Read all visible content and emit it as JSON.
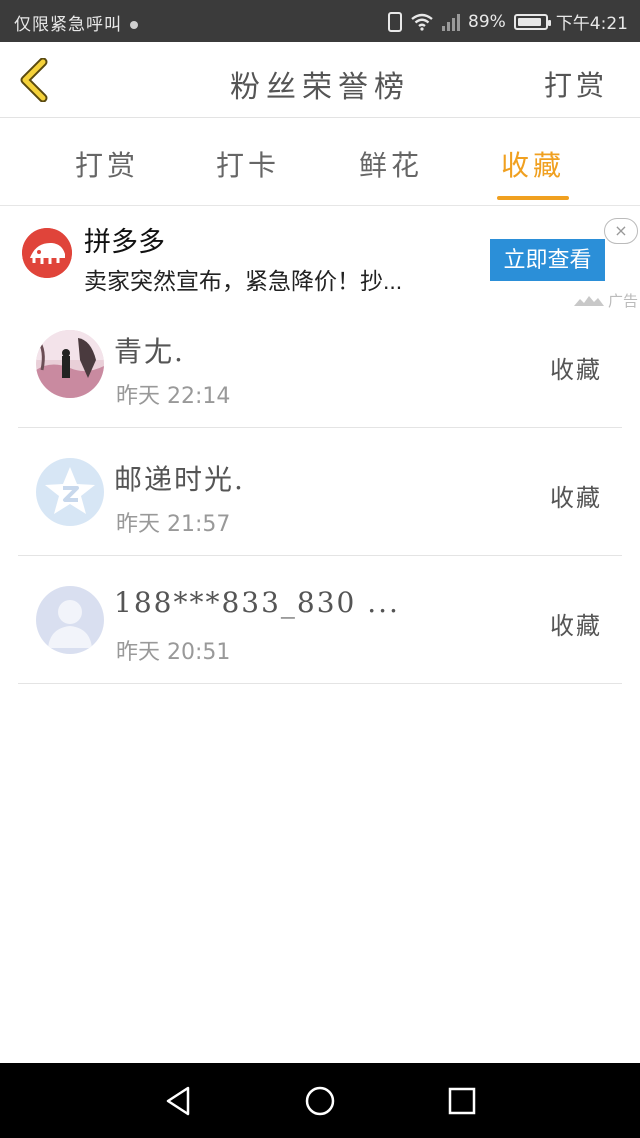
{
  "status_bar": {
    "carrier_text": "仅限紧急呼叫",
    "battery_level": "89%",
    "battery_fraction": 0.89,
    "clock": "下午4:21"
  },
  "header": {
    "title": "粉丝荣誉榜",
    "right_action": "打赏"
  },
  "tabs": [
    {
      "label": "打赏",
      "active": false
    },
    {
      "label": "打卡",
      "active": false
    },
    {
      "label": "鲜花",
      "active": false
    },
    {
      "label": "收藏",
      "active": true
    }
  ],
  "ad": {
    "title": "拼多多",
    "description": "卖家突然宣布，紧急降价！抄...",
    "button": "立即查看",
    "close": "×",
    "tag": "广告"
  },
  "list": [
    {
      "name": "青尢.",
      "time": "昨天 22:14",
      "action": "收藏"
    },
    {
      "name": "邮递时光.",
      "time": "昨天 21:57",
      "action": "收藏"
    },
    {
      "name": "188***833_830 ...",
      "time": "昨天 20:51",
      "action": "收藏"
    }
  ],
  "colors": {
    "accent": "#f0a020",
    "ad_button": "#2b8fd8",
    "status_bar": "#3b3b3b",
    "nav_bar": "#000000"
  }
}
